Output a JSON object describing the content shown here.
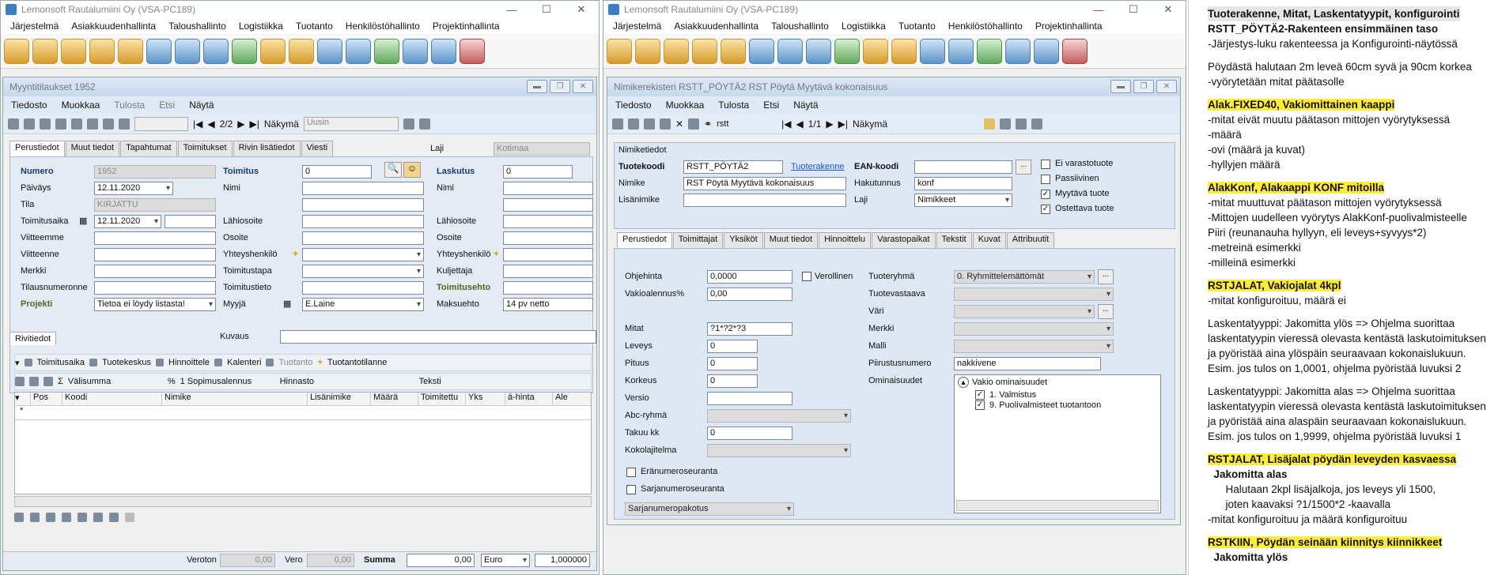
{
  "left_window": {
    "title": "Lemonsoft Rautalumiini Oy (VSA-PC189)",
    "menu": [
      "Järjestelmä",
      "Asiakkuudenhallinta",
      "Taloushallinto",
      "Logistiikka",
      "Tuotanto",
      "Henkilöstöhallinto",
      "Projektinhallinta"
    ],
    "child": {
      "title": "Myyntitilaukset 1952",
      "menu": [
        "Tiedosto",
        "Muokkaa",
        "Tulosta",
        "Etsi",
        "Näytä"
      ],
      "pager": "2/2",
      "view_label": "Näkymä",
      "view_value": "Uusin",
      "tabs": [
        "Perustiedot",
        "Muut tiedot",
        "Tapahtumat",
        "Toimitukset",
        "Rivin lisätiedot",
        "Viesti"
      ],
      "laji_label": "Laji",
      "laji_value": "Kotimaa",
      "fields": {
        "numero_label": "Numero",
        "numero": "1952",
        "paivays_label": "Päiväys",
        "paivays": "12.11.2020",
        "tila_label": "Tila",
        "tila": "KIRJATTU",
        "toimitusaika_label": "Toimitusaika",
        "toimitusaika": "12.11.2020",
        "vitteemme_label": "Viitteemme",
        "vitteenne_label": "Viitteenne",
        "merkki_label": "Merkki",
        "tilausnumeronne_label": "Tilausnumeronne",
        "projekti_label": "Projekti",
        "projekti": "Tietoa ei löydy listasta!",
        "toimitus_label": "Toimitus",
        "toimitus": "0",
        "nimi_label": "Nimi",
        "lahiosoite_label": "Lähiosoite",
        "osoite_label": "Osoite",
        "yhteyshenkilo_label": "Yhteyshenkilö",
        "toimitustapa_label": "Toimitustapa",
        "toimitustieto_label": "Toimitustieto",
        "myyja_label": "Myyjä",
        "myyja": "E.Laine",
        "laskutus_label": "Laskutus",
        "laskutus": "0",
        "nimi2_label": "Nimi",
        "lahiosoite2_label": "Lähiosoite",
        "osoite2_label": "Osoite",
        "yhteyshenkilo2_label": "Yhteyshenkilö",
        "kuljettaja_label": "Kuljettaja",
        "toimitusehto_label": "Toimitusehto",
        "maksuehto_label": "Maksuehto",
        "maksuehto": "14 pv netto"
      },
      "rivitiedot_tab": "Rivitiedot",
      "kuvaus_label": "Kuvaus",
      "row_toolbar": [
        "Toimitusaika",
        "Tuotekeskus",
        "Hinnoittele",
        "Kalenteri",
        "Tuotanto",
        "Tuotantotilanne"
      ],
      "row_toolbar2": {
        "valisumma": "Välisumma",
        "percent": "%",
        "sopimus": "1 Sopimusalennus",
        "hinnasto": "Hinnasto",
        "teksti": "Teksti"
      },
      "grid_headers": [
        "Pos",
        "Koodi",
        "Nimike",
        "Lisänimike",
        "Määrä",
        "Toimitettu",
        "Yks",
        "á-hinta",
        "Ale"
      ],
      "new_row_marker": "*",
      "bottom": {
        "veroton_label": "Veroton",
        "veroton": "0,00",
        "vero_label": "Vero",
        "vero": "0,00",
        "summa_label": "Summa",
        "summa": "0,00",
        "currency": "Euro",
        "rate": "1,000000"
      }
    }
  },
  "right_window": {
    "title": "Lemonsoft Rautalumiini Oy (VSA-PC189)",
    "menu": [
      "Järjestelmä",
      "Asiakkuudenhallinta",
      "Taloushallinto",
      "Logistiikka",
      "Tuotanto",
      "Henkilöstöhallinto",
      "Projektinhallinta"
    ],
    "child": {
      "title": "Nimikerekisteri RSTT_PÖYTÄ2 RST Pöytä Myytävä kokonaisuus",
      "menu": [
        "Tiedosto",
        "Muokkaa",
        "Tulosta",
        "Etsi",
        "Näytä"
      ],
      "search": "rstt",
      "pager": "1/1",
      "view_label": "Näkymä",
      "nimiketiedot": "Nimiketiedot",
      "tuotekoodi_label": "Tuotekoodi",
      "tuotekoodi": "RSTT_PÖYTÄ2",
      "tuoterakenne_link": "Tuoterakenne",
      "ean_label": "EAN-koodi",
      "nimike_label": "Nimike",
      "nimike": "RST Pöytä Myytävä kokonaisuus",
      "hakutunnus_label": "Hakutunnus",
      "hakutunnus": "konf",
      "lisanimike_label": "Lisänimike",
      "laji_label": "Laji",
      "laji": "Nimikkeet",
      "checks": [
        {
          "label": "Ei varastotuote",
          "checked": false
        },
        {
          "label": "Passiivinen",
          "checked": false
        },
        {
          "label": "Myytävä tuote",
          "checked": true
        },
        {
          "label": "Ostettava tuote",
          "checked": true
        }
      ],
      "tabs": [
        "Perustiedot",
        "Toimittajat",
        "Yksiköt",
        "Muut tiedot",
        "Hinnoittelu",
        "Varastopaikat",
        "Tekstit",
        "Kuvat",
        "Attribuutit"
      ],
      "fields": {
        "ohjehinta_label": "Ohjehinta",
        "ohjehinta": "0,0000",
        "verollinen_label": "Verollinen",
        "vakioalennus_label": "Vakioalennus%",
        "vakioalennus": "0,00",
        "mitat_label": "Mitat",
        "mitat": "?1*?2*?3",
        "leveys_label": "Leveys",
        "leveys": "0",
        "pituus_label": "Pituus",
        "pituus": "0",
        "korkeus_label": "Korkeus",
        "korkeus": "0",
        "versio_label": "Versio",
        "abc_label": "Abc-ryhmä",
        "takuu_label": "Takuu kk",
        "takuu": "0",
        "kokolajitelma_label": "Kokolajitelma",
        "eranumero_label": "Eränumeroseuranta",
        "sarjanumero_label": "Sarjanumeroseuranta",
        "sarjanumeropakotus": "Sarjanumeropakotus",
        "tuoteryhma_label": "Tuoteryhmä",
        "tuoteryhma": "0. Ryhmittelemättömät",
        "tuotevastaava_label": "Tuotevastaava",
        "vari_label": "Väri",
        "merkki_label": "Merkki",
        "malli_label": "Malli",
        "piirustusnumero_label": "Piirustusnumero",
        "piirustusnumero": "nakkivene",
        "ominaisuudet_label": "Ominaisuudet"
      },
      "tree": {
        "root": "Vakio ominaisuudet",
        "items": [
          "1. Valmistus",
          "9. Puolivalmisteet tuotantoon"
        ]
      }
    }
  },
  "notes": {
    "lines": [
      {
        "t": "Tuoterakenne, Mitat, Laskentatyypit, konfigurointi",
        "style": "title"
      },
      {
        "t": "RSTT_PÖYTÄ2-Rakenteen ensimmäinen taso",
        "style": "mixed_bold_first"
      },
      {
        "t": " -Järjestys-luku rakenteessa ja Konfigurointi-näytössä",
        "style": "normal"
      },
      {
        "t": "",
        "style": "gap"
      },
      {
        "t": "Pöydästä halutaan 2m leveä 60cm syvä ja 90cm korkea",
        "style": "normal"
      },
      {
        "t": " -vyörytetään mitat päätasolle",
        "style": "normal"
      },
      {
        "t": "",
        "style": "gap"
      },
      {
        "t": "Alak.FIXED40, Vakiomittainen kaappi",
        "style": "hl_first"
      },
      {
        "t": " -mitat eivät muutu päätason mittojen vyörytyksessä",
        "style": "normal"
      },
      {
        "t": " -määrä",
        "style": "normal"
      },
      {
        "t": " -ovi (määrä ja kuvat)",
        "style": "normal"
      },
      {
        "t": " -hyllyjen määrä",
        "style": "normal"
      },
      {
        "t": "",
        "style": "gap"
      },
      {
        "t": "AlakKonf, Alakaappi KONF mitoilla",
        "style": "hl_first"
      },
      {
        "t": " -mitat muuttuvat päätason mittojen vyörytyksessä",
        "style": "normal"
      },
      {
        "t": " -Mittojen uudelleen vyörytys AlakKonf-puolivalmisteelle",
        "style": "normal"
      },
      {
        "t": " Piiri (reunanauha hyllyyn, eli leveys+syvyys*2)",
        "style": "normal"
      },
      {
        "t": " -metreinä esimerkki",
        "style": "normal"
      },
      {
        "t": " -milleinä esimerkki",
        "style": "normal"
      },
      {
        "t": "",
        "style": "gap"
      },
      {
        "t": "RSTJALAT, Vakiojalat 4kpl",
        "style": "hl_first"
      },
      {
        "t": " -mitat konfiguroituu, määrä ei",
        "style": "normal"
      },
      {
        "t": "",
        "style": "gap"
      },
      {
        "t": "Laskentatyyppi: Jakomitta ylös => Ohjelma suorittaa",
        "style": "normal"
      },
      {
        "t": "laskentatyypin vieressä olevasta kentästä laskutoimituksen",
        "style": "normal"
      },
      {
        "t": "ja pyöristää aina ylöspäin seuraavaan kokonaislukuun.",
        "style": "normal"
      },
      {
        "t": "Esim. jos tulos on 1,0001, ohjelma pyöristää luvuksi 2",
        "style": "normal"
      },
      {
        "t": "",
        "style": "gap"
      },
      {
        "t": "Laskentatyyppi: Jakomitta alas => Ohjelma suorittaa",
        "style": "normal"
      },
      {
        "t": "laskentatyypin vieressä olevasta kentästä laskutoimituksen",
        "style": "normal"
      },
      {
        "t": "ja pyöristää aina alaspäin seuraavaan kokonaislukuun.",
        "style": "normal"
      },
      {
        "t": "Esim. jos tulos on 1,9999, ohjelma pyöristää luvuksi 1",
        "style": "normal"
      },
      {
        "t": "",
        "style": "gap"
      },
      {
        "t": "RSTJALAT, Lisäjalat pöydän leveyden kasvaessa",
        "style": "hl_first"
      },
      {
        "t": "  Jakomitta alas",
        "style": "bold"
      },
      {
        "t": "      Halutaan 2kpl lisäjalkoja, jos leveys yli 1500,",
        "style": "normal"
      },
      {
        "t": "      joten kaavaksi ?1/1500*2 -kaavalla",
        "style": "normal"
      },
      {
        "t": " -mitat konfiguroituu ja määrä konfiguroituu",
        "style": "normal"
      },
      {
        "t": "",
        "style": "gap"
      },
      {
        "t": "RSTKIIN, Pöydän seinään kiinnitys kiinnikkeet",
        "style": "hl_first"
      },
      {
        "t": "  Jakomitta ylös",
        "style": "bold"
      }
    ]
  }
}
